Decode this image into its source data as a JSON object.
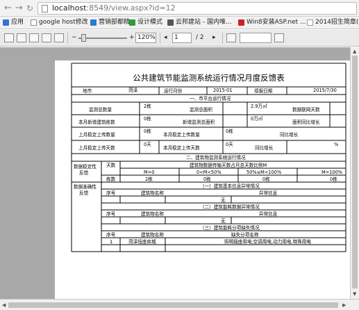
{
  "browser": {
    "url_host": "localhost",
    "url_rest": ":8549/view.aspx?id=12"
  },
  "bookmarks": [
    {
      "label": "应用",
      "color": "#3b6fd6"
    },
    {
      "label": "google host修改",
      "color": "#888888"
    },
    {
      "label": "营销部都精",
      "color": "#2a7bd0"
    },
    {
      "label": "设计模式",
      "color": "#2f9a3a"
    },
    {
      "label": "云邦建站 - 国内唯...",
      "color": "#555555"
    },
    {
      "label": "Win8安装ASP.net ...",
      "color": "#d42020"
    },
    {
      "label": "2014招生简章(江苏",
      "color": "#999999"
    }
  ],
  "toolbar": {
    "zoom": "120%",
    "page_current": "1",
    "page_total": "/ 2"
  },
  "report": {
    "title": "公共建筑节能监测系统运行情况月度反馈表",
    "city_label": "地市",
    "city_value": "菏泽",
    "month_label": "运行月份",
    "month_value": "2015-01",
    "fill_date_label": "填报日期",
    "fill_date_value": "2015/7/30",
    "section1": "一、市平台运行情况",
    "monitor_total_label": "监测总数量",
    "monitor_total_value": "2栋",
    "monitor_area_label": "监测总面积",
    "monitor_area_value": "2.9万㎡",
    "networked_label": "数据联网天数",
    "new_bld_label": "本月新增建筑栋数",
    "new_bld_value": "0栋",
    "new_area_label": "新增监测总面积",
    "new_area_value": "0万㎡",
    "yoy_area_label": "面积同比增长",
    "upload_qty_label": "上月稳定上传数量",
    "upload_qty_value": "0栋",
    "this_upload_qty_label": "本月稳定上传数量",
    "this_upload_qty_value": "0栋",
    "yoy1_label": "同比增长",
    "upload_days_label": "上月稳定上传天数",
    "upload_days_value": "0天",
    "this_upload_days_label": "本月稳定上传天数",
    "this_upload_days_value": "0天",
    "yoy2_label": "同比增长",
    "yoy2_value": "%",
    "section2": "二、建筑物监测系统运行情况",
    "stability_label_1": "数据稳定性",
    "stability_label_2": "反馈",
    "days_label": "天数",
    "ratio_header": "建筑物数据传输天数占月总天数比例M",
    "m0": "M=0",
    "m1": "0<M<50%",
    "m2": "50%≤M<100%",
    "m3": "M=100%",
    "buildings_label": "栋数",
    "b0": "2栋",
    "b1": "0栋",
    "b2": "0栋",
    "b3": "0栋",
    "accuracy_label_1": "数据准确性",
    "accuracy_label_2": "反馈",
    "sub1": "（一）建筑基本信息异常情况",
    "seq1": "序号",
    "name1": "建筑物名称",
    "abn1": "异常信息",
    "none1": "无",
    "sub2": "（二）建筑能耗数据异常情况",
    "seq2": "序号",
    "name2": "建筑物名称",
    "abn2": "异常信息",
    "none2": "无",
    "sub3": "（三）建筑能耗分项缺失情况",
    "seq3": "序号",
    "name3": "建筑物名称",
    "missing3": "缺失分项名称",
    "row_no": "1",
    "row_name": "菏泽恒座商城",
    "row_missing": "照明插座用电,空调用电,动力用电,特殊用电"
  }
}
